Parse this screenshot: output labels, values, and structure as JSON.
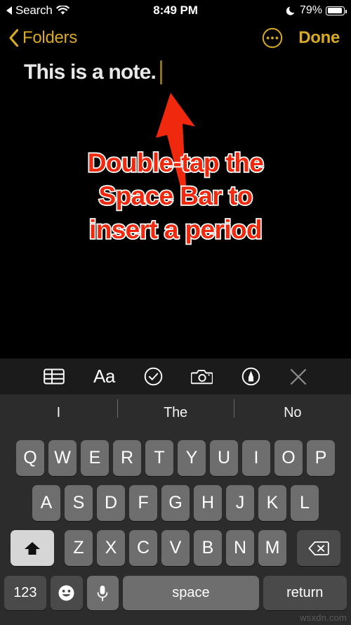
{
  "status_bar": {
    "back_label": "Search",
    "back_icon": "back-triangle-icon",
    "wifi_icon": "wifi-icon",
    "time": "8:49 PM",
    "dnd_icon": "moon-icon",
    "battery_percent": "79%",
    "battery_icon": "battery-icon"
  },
  "nav_bar": {
    "back_label": "Folders",
    "back_icon": "chevron-left-icon",
    "more_icon": "more-circle-icon",
    "done_label": "Done",
    "accent_color": "#D8A827"
  },
  "note": {
    "text": "This is a note.",
    "cursor_visible": true,
    "text_color": "#E8E8E8"
  },
  "annotation": {
    "arrow_icon": "up-arrow-annotation",
    "arrow_color": "#F0280D",
    "text_color": "#F0280D",
    "outline_color": "#FFFFFF",
    "lines": [
      "Double-tap the",
      "Space Bar to",
      "insert a period"
    ]
  },
  "keyboard_toolbar": {
    "items": [
      {
        "name": "table-icon",
        "label": ""
      },
      {
        "name": "text-format-icon",
        "label": "Aa"
      },
      {
        "name": "checklist-icon",
        "label": ""
      },
      {
        "name": "camera-icon",
        "label": ""
      },
      {
        "name": "markup-pen-icon",
        "label": ""
      },
      {
        "name": "close-icon",
        "label": ""
      }
    ]
  },
  "predictive": {
    "suggestions": [
      "I",
      "The",
      "No"
    ]
  },
  "keyboard": {
    "row1": [
      "Q",
      "W",
      "E",
      "R",
      "T",
      "Y",
      "U",
      "I",
      "O",
      "P"
    ],
    "row2": [
      "A",
      "S",
      "D",
      "F",
      "G",
      "H",
      "J",
      "K",
      "L"
    ],
    "row3_letters": [
      "Z",
      "X",
      "C",
      "V",
      "B",
      "N",
      "M"
    ],
    "shift_label": "",
    "shift_icon": "shift-up-arrow-icon",
    "shift_active": true,
    "delete_icon": "delete-backspace-icon",
    "numbers_label": "123",
    "emoji_icon": "emoji-smiley-icon",
    "dictation_icon": "microphone-icon",
    "space_label": "space",
    "return_label": "return",
    "key_color": "#6E6E6E",
    "modifier_color": "#4A4A4A",
    "background": "#2C2C2C"
  },
  "watermark": {
    "text": "wsxdn.com"
  }
}
